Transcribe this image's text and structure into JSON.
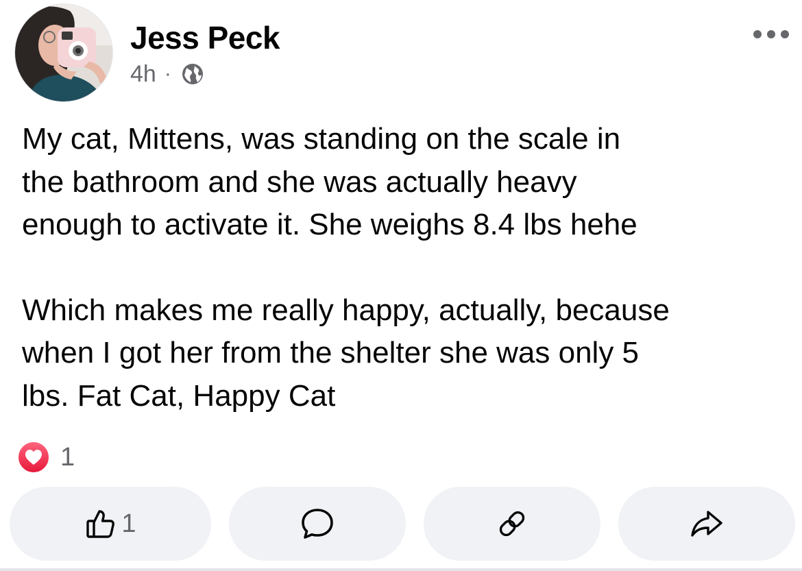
{
  "post": {
    "author": "Jess Peck",
    "time": "4h",
    "separator": "·",
    "audience_icon": "globe-icon",
    "more_icon": "more-horizontal-icon",
    "paragraphs": [
      "My cat, Mittens, was standing on the scale in\nthe bathroom and she was actually heavy\nenough to activate it. She weighs 8.4 lbs hehe",
      "Which makes me really happy, actually, because\nwhen I got her from the shelter she was only 5\nlbs. Fat Cat, Happy Cat"
    ]
  },
  "reactions": {
    "icon": "love-reaction-icon",
    "count": "1"
  },
  "actions": {
    "like": {
      "icon": "thumbs-up-icon",
      "count": "1"
    },
    "comment": {
      "icon": "comment-icon"
    },
    "copy_link": {
      "icon": "link-icon"
    },
    "share": {
      "icon": "share-icon"
    }
  },
  "colors": {
    "text": "#050505",
    "secondary_text": "#65676b",
    "button_background": "#f0f2f5",
    "love_reaction": "#f33e58"
  }
}
